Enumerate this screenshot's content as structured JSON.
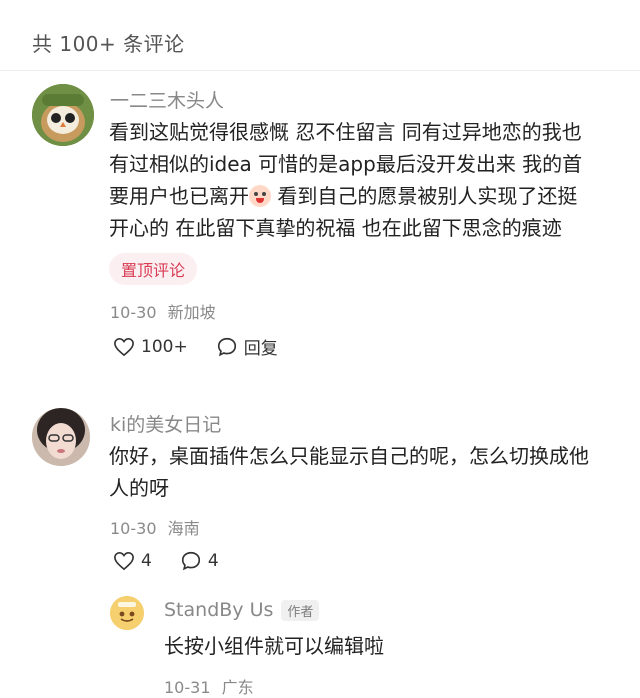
{
  "header": {
    "title": "共 100+ 条评论"
  },
  "comments": [
    {
      "username": "一二三木头人",
      "content_lines": [
        "看到这贴觉得很感慨 忍不住留言 同有过异地恋的我也",
        "有过相似的idea 可惜的是app最后没开发出来 我的首",
        "要用户也已离开",
        "看到自己的愿景被别人实现了还挺",
        "开心的 在此留下真挚的祝福 也在此留下思念的痕迹"
      ],
      "emoji_icon": "crying-face-emoji",
      "badge": "置顶评论",
      "date": "10-30",
      "location": "新加坡",
      "likes": "100+",
      "reply_label": "回复"
    },
    {
      "username": "ki的美女日记",
      "content_lines": [
        "你好，桌面插件怎么只能显示自己的呢，怎么切换成他",
        "人的呀"
      ],
      "date": "10-30",
      "location": "海南",
      "likes": "4",
      "replies": "4",
      "reply": {
        "username": "StandBy Us",
        "author_tag": "作者",
        "content": "长按小组件就可以编辑啦",
        "date": "10-31",
        "location": "广东"
      }
    }
  ],
  "colors": {
    "badge_text": "#d93c55",
    "badge_bg": "#fbeff1",
    "meta": "#8a8a8a"
  }
}
